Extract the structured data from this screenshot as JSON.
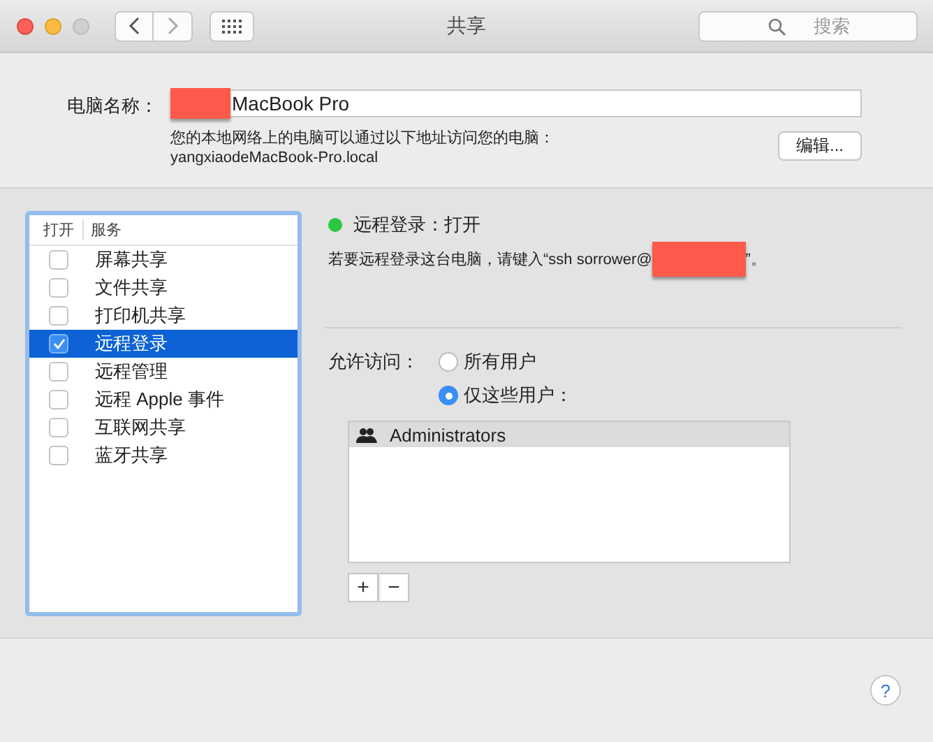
{
  "window": {
    "title": "共享"
  },
  "search": {
    "placeholder": "搜索"
  },
  "computer_name": {
    "label": "电脑名称：",
    "redacted_prefix": true,
    "value": "MacBook Pro",
    "note": "您的本地网络上的电脑可以通过以下地址访问您的电脑：",
    "address": "yangxiaodeMacBook-Pro.local",
    "edit_button": "编辑..."
  },
  "services": {
    "columns": [
      "打开",
      "服务"
    ],
    "rows": [
      {
        "label": "屏幕共享",
        "checked": false,
        "selected": false
      },
      {
        "label": "文件共享",
        "checked": false,
        "selected": false
      },
      {
        "label": "打印机共享",
        "checked": false,
        "selected": false
      },
      {
        "label": "远程登录",
        "checked": true,
        "selected": true
      },
      {
        "label": "远程管理",
        "checked": false,
        "selected": false
      },
      {
        "label": "远程 Apple 事件",
        "checked": false,
        "selected": false
      },
      {
        "label": "互联网共享",
        "checked": false,
        "selected": false
      },
      {
        "label": "蓝牙共享",
        "checked": false,
        "selected": false
      }
    ]
  },
  "status": {
    "on": true,
    "text": "远程登录：打开"
  },
  "instruction": {
    "before": "若要远程登录这台电脑，请键入“ssh sorrower@",
    "redacted": true,
    "after": "”。"
  },
  "access": {
    "label": "允许访问：",
    "options": [
      {
        "label": "所有用户",
        "selected": false
      },
      {
        "label": "仅这些用户：",
        "selected": true
      }
    ],
    "users": [
      {
        "name": "Administrators",
        "selected": true
      }
    ],
    "buttons": [
      "+",
      "−"
    ]
  },
  "help": "?"
}
